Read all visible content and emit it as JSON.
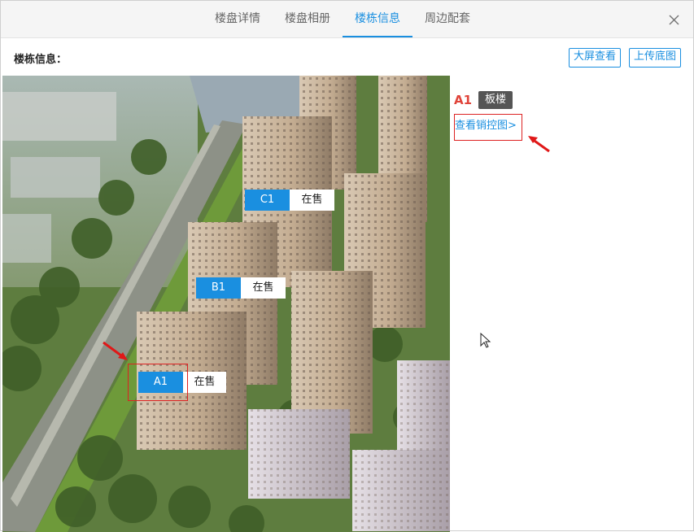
{
  "tabs": [
    {
      "label": "楼盘详情",
      "active": false
    },
    {
      "label": "楼盘相册",
      "active": false
    },
    {
      "label": "楼栋信息",
      "active": true
    },
    {
      "label": "周边配套",
      "active": false
    }
  ],
  "close_icon": "close-icon",
  "toolbar": {
    "label": "楼栋信息：",
    "fullscreen_label": "大屏查看",
    "upload_label": "上传底图"
  },
  "buildings": [
    {
      "code": "C1",
      "status": "在售"
    },
    {
      "code": "B1",
      "status": "在售"
    },
    {
      "code": "A1",
      "status": "在售"
    }
  ],
  "selected": {
    "code": "A1",
    "type": "板楼",
    "link": "查看销控图>"
  },
  "colors": {
    "accent": "#1a8fe0",
    "highlight": "#dd2222",
    "selected_code": "#e0443a"
  }
}
